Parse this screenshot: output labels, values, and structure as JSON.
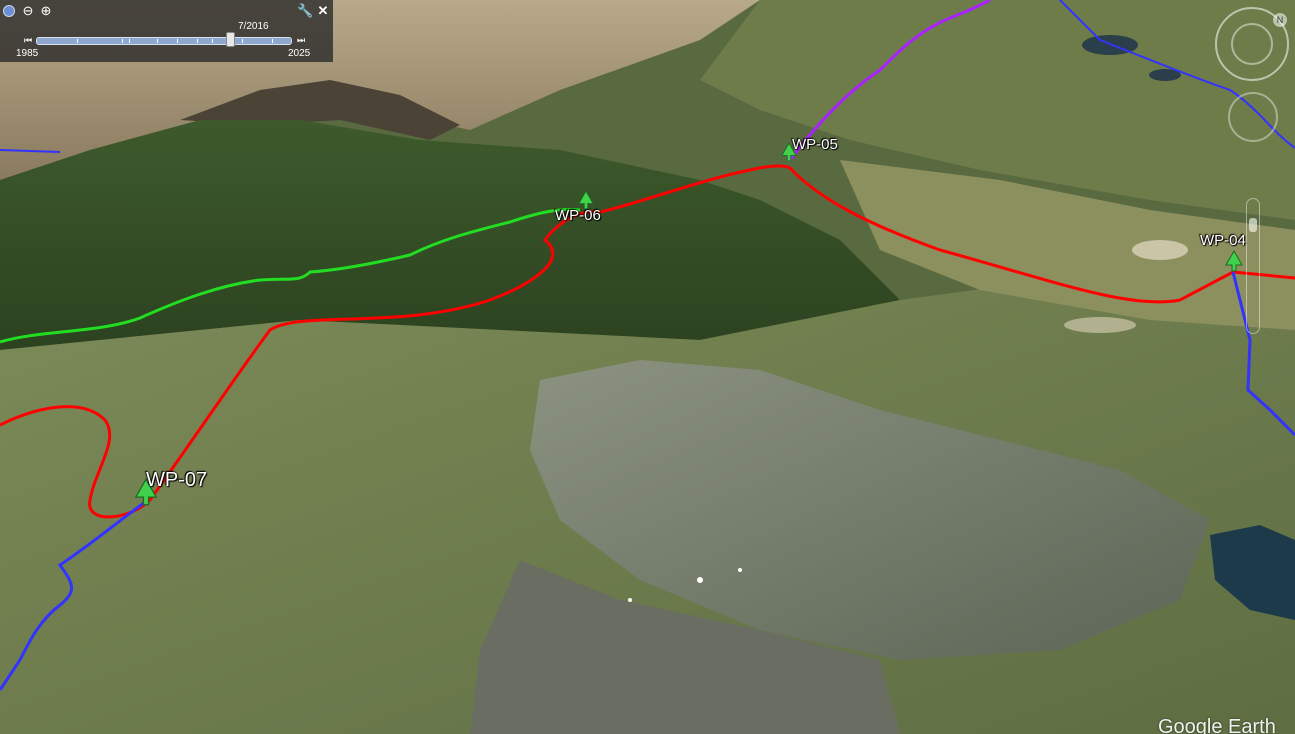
{
  "map": {
    "waypoints": [
      {
        "id": "WP-04",
        "icon": "tree-icon"
      },
      {
        "id": "WP-05",
        "icon": "tree-icon"
      },
      {
        "id": "WP-06",
        "icon": "tree-icon"
      },
      {
        "id": "WP-07",
        "icon": "tree-icon"
      }
    ],
    "tracks": [
      {
        "name": "red-track",
        "color": "#ff0000"
      },
      {
        "name": "green-track",
        "color": "#22dd22"
      },
      {
        "name": "blue-track",
        "color": "#3333ff"
      },
      {
        "name": "purple-track",
        "color": "#aa22ff"
      }
    ],
    "watermark": "Google Earth"
  },
  "history": {
    "current_date": "7/2016",
    "start_year": "1985",
    "end_year": "2025",
    "icons": [
      "clock-icon",
      "zoom-out-icon",
      "zoom-in-icon",
      "wrench-icon",
      "close-icon",
      "prev-icon",
      "next-icon"
    ]
  },
  "nav": {
    "north_icon": "north-icon"
  }
}
